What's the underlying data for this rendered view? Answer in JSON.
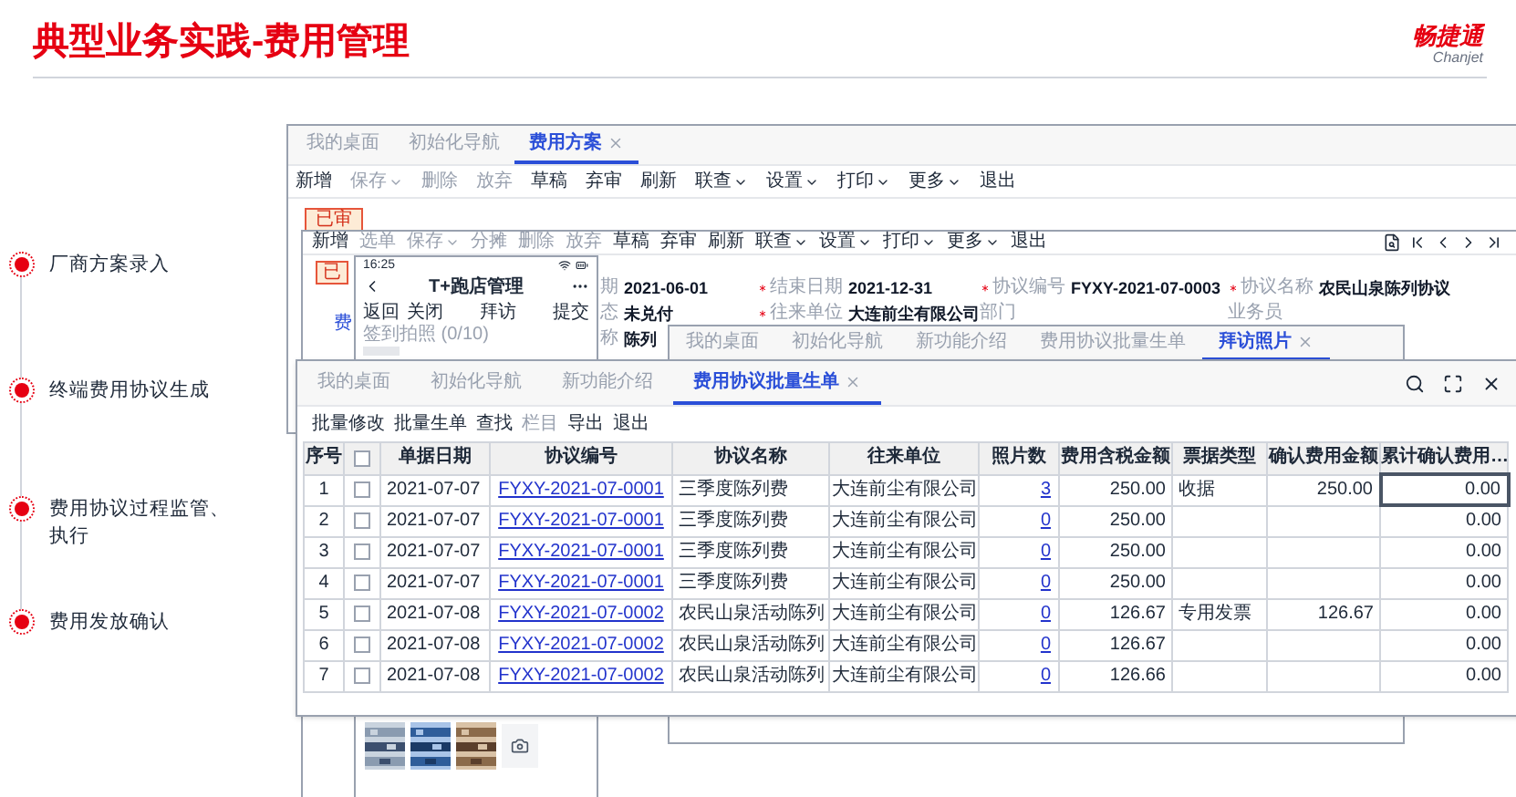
{
  "slide_title": "典型业务实践-费用管理",
  "logo": {
    "name": "畅捷通",
    "latin": "Chanjet"
  },
  "timeline": [
    {
      "label": "厂商方案录入"
    },
    {
      "label": "终端费用协议生成"
    },
    {
      "label": "费用协议过程监管、执行"
    },
    {
      "label": "费用发放确认"
    }
  ],
  "plan_window": {
    "tabs": [
      {
        "label": "我的桌面",
        "selected": false
      },
      {
        "label": "初始化导航",
        "selected": false
      },
      {
        "label": "费用方案",
        "selected": true
      }
    ],
    "toolbar": [
      {
        "label": "新增",
        "disabled": false,
        "dropdown": false
      },
      {
        "label": "保存",
        "disabled": true,
        "dropdown": true
      },
      {
        "label": "删除",
        "disabled": true,
        "dropdown": false
      },
      {
        "label": "放弃",
        "disabled": true,
        "dropdown": false
      },
      {
        "label": "草稿",
        "disabled": false,
        "dropdown": false
      },
      {
        "label": "弃审",
        "disabled": false,
        "dropdown": false
      },
      {
        "label": "刷新",
        "disabled": false,
        "dropdown": false
      },
      {
        "label": "联查",
        "disabled": false,
        "dropdown": true
      },
      {
        "label": "设置",
        "disabled": false,
        "dropdown": true
      },
      {
        "label": "打印",
        "disabled": false,
        "dropdown": true
      },
      {
        "label": "更多",
        "disabled": false,
        "dropdown": true
      },
      {
        "label": "退出",
        "disabled": false,
        "dropdown": false
      }
    ],
    "status_badge": "已审"
  },
  "agreement_window": {
    "toolbar": [
      {
        "label": "新增",
        "disabled": false,
        "dropdown": false
      },
      {
        "label": "选单",
        "disabled": true,
        "dropdown": false
      },
      {
        "label": "保存",
        "disabled": true,
        "dropdown": true
      },
      {
        "label": "分摊",
        "disabled": true,
        "dropdown": false
      },
      {
        "label": "删除",
        "disabled": true,
        "dropdown": false
      },
      {
        "label": "放弃",
        "disabled": true,
        "dropdown": false
      },
      {
        "label": "草稿",
        "disabled": false,
        "dropdown": false
      },
      {
        "label": "弃审",
        "disabled": false,
        "dropdown": false
      },
      {
        "label": "刷新",
        "disabled": false,
        "dropdown": false
      },
      {
        "label": "联查",
        "disabled": false,
        "dropdown": true
      },
      {
        "label": "设置",
        "disabled": false,
        "dropdown": true
      },
      {
        "label": "打印",
        "disabled": false,
        "dropdown": true
      },
      {
        "label": "更多",
        "disabled": false,
        "dropdown": true
      },
      {
        "label": "退出",
        "disabled": false,
        "dropdown": false
      }
    ],
    "status_badge": "已",
    "side_link": "费",
    "field_rows": [
      [
        {
          "label": "期",
          "value": "2021-06-01",
          "required": false
        },
        {
          "label": "结束日期",
          "value": "2021-12-31",
          "required": true
        },
        {
          "label": "协议编号",
          "value": "FYXY-2021-07-0003",
          "required": true
        },
        {
          "label": "协议名称",
          "value": "农民山泉陈列协议",
          "required": true
        }
      ],
      [
        {
          "label": "态",
          "value": "未兑付",
          "required": false
        },
        {
          "label": "往来单位",
          "value": "大连前尘有限公司",
          "required": true
        },
        {
          "label": "部门",
          "required": false
        },
        {
          "label": "业务员",
          "required": false
        }
      ],
      [
        {
          "label": "称",
          "value": "陈列",
          "required": false
        }
      ]
    ]
  },
  "mobile_app": {
    "time": "16:25",
    "title": "T+跑店管理",
    "left_actions": [
      "返回",
      "关闭"
    ],
    "center_action": "拜访",
    "right_action": "提交",
    "section": "签到拍照 (0/10)",
    "photos": [
      {
        "kind": "picture"
      },
      {
        "kind": "picture"
      },
      {
        "kind": "picture"
      }
    ]
  },
  "photo_window": {
    "tabs": [
      {
        "label": "我的桌面",
        "selected": false
      },
      {
        "label": "初始化导航",
        "selected": false
      },
      {
        "label": "新功能介绍",
        "selected": false
      },
      {
        "label": "费用协议批量生单",
        "selected": false
      },
      {
        "label": "拜访照片",
        "selected": true
      }
    ]
  },
  "batch_window": {
    "tabs": [
      {
        "label": "我的桌面",
        "selected": false
      },
      {
        "label": "初始化导航",
        "selected": false
      },
      {
        "label": "新功能介绍",
        "selected": false
      },
      {
        "label": "费用协议批量生单",
        "selected": true
      }
    ],
    "toolbar": [
      {
        "label": "批量修改",
        "disabled": false
      },
      {
        "label": "批量生单",
        "disabled": false
      },
      {
        "label": "查找",
        "disabled": false
      },
      {
        "label": "栏目",
        "disabled": true
      },
      {
        "label": "导出",
        "disabled": false
      },
      {
        "label": "退出",
        "disabled": false
      }
    ],
    "table": {
      "columns": [
        "序号",
        "单据日期",
        "协议编号",
        "协议名称",
        "往来单位",
        "照片数",
        "费用含税金额",
        "票据类型",
        "确认费用金额",
        "累计确认费用…"
      ],
      "all_checked": false,
      "rows": [
        {
          "seq": "1",
          "checked": false,
          "date": "2021-07-07",
          "code": "FYXY-2021-07-0001",
          "name": "三季度陈列费",
          "partner": "大连前尘有限公司",
          "photos": "3",
          "amount": "250.00",
          "invoice_type": "收据",
          "confirmed": "250.00",
          "cumulative": "0.00",
          "editing": true
        },
        {
          "seq": "2",
          "checked": false,
          "date": "2021-07-07",
          "code": "FYXY-2021-07-0001",
          "name": "三季度陈列费",
          "partner": "大连前尘有限公司",
          "photos": "0",
          "amount": "250.00",
          "cumulative": "0.00",
          "editing": false
        },
        {
          "seq": "3",
          "checked": false,
          "date": "2021-07-07",
          "code": "FYXY-2021-07-0001",
          "name": "三季度陈列费",
          "partner": "大连前尘有限公司",
          "photos": "0",
          "amount": "250.00",
          "cumulative": "0.00",
          "editing": false
        },
        {
          "seq": "4",
          "checked": false,
          "date": "2021-07-07",
          "code": "FYXY-2021-07-0001",
          "name": "三季度陈列费",
          "partner": "大连前尘有限公司",
          "photos": "0",
          "amount": "250.00",
          "cumulative": "0.00",
          "editing": false
        },
        {
          "seq": "5",
          "checked": false,
          "date": "2021-07-08",
          "code": "FYXY-2021-07-0002",
          "name": "农民山泉活动陈列",
          "partner": "大连前尘有限公司",
          "photos": "0",
          "amount": "126.67",
          "invoice_type": "专用发票",
          "confirmed": "126.67",
          "cumulative": "0.00",
          "editing": false
        },
        {
          "seq": "6",
          "checked": false,
          "date": "2021-07-08",
          "code": "FYXY-2021-07-0002",
          "name": "农民山泉活动陈列",
          "partner": "大连前尘有限公司",
          "photos": "0",
          "amount": "126.67",
          "cumulative": "0.00",
          "editing": false
        },
        {
          "seq": "7",
          "checked": false,
          "date": "2021-07-08",
          "code": "FYXY-2021-07-0002",
          "name": "农民山泉活动陈列",
          "partner": "大连前尘有限公司",
          "photos": "0",
          "amount": "126.66",
          "cumulative": "0.00",
          "editing": false
        }
      ]
    }
  }
}
